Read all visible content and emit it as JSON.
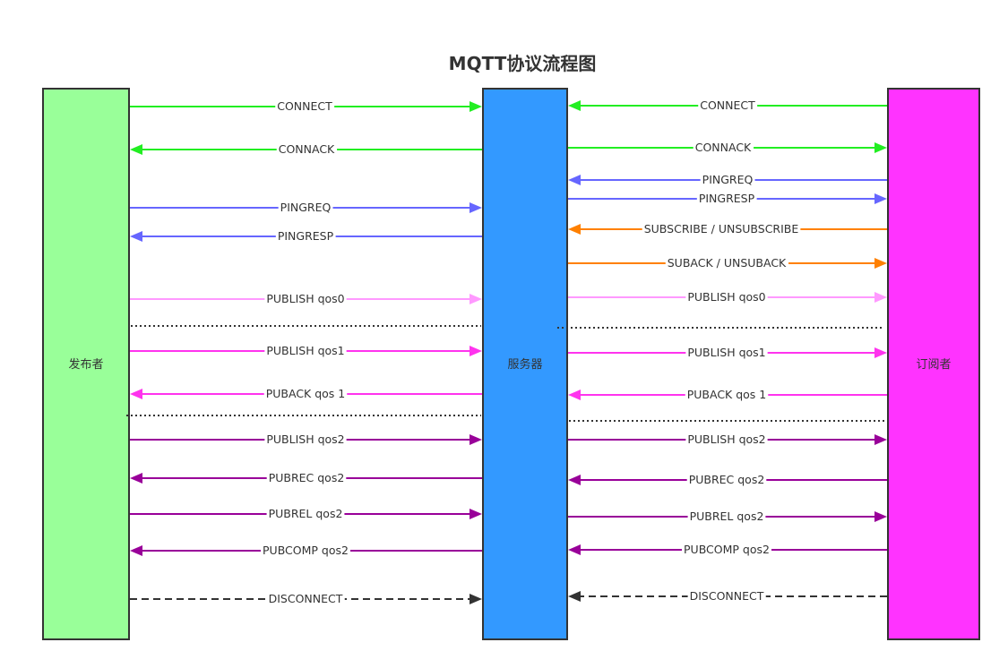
{
  "title": "MQTT协议流程图",
  "colors": {
    "connect": "#22ee22",
    "ping": "#6666ff",
    "subscribe": "#ff8000",
    "qos0": "#ff99ff",
    "qos1": "#ff33ee",
    "qos2": "#990099",
    "disconnect": "#333333",
    "separator": "#333333"
  },
  "lanes": [
    {
      "id": "publisher",
      "label": "发布者",
      "fill": "#99ff99"
    },
    {
      "id": "server",
      "label": "服务器",
      "fill": "#3399ff"
    },
    {
      "id": "subscriber",
      "label": "订阅者",
      "fill": "#ff33ff"
    }
  ],
  "messages_left": [
    {
      "label": "CONNECT",
      "direction": "to-server",
      "color": "connect",
      "style": "solid"
    },
    {
      "label": "CONNACK",
      "direction": "to-client",
      "color": "connect",
      "style": "solid"
    },
    {
      "label": "PINGREQ",
      "direction": "to-server",
      "color": "ping",
      "style": "solid"
    },
    {
      "label": "PINGRESP",
      "direction": "to-client",
      "color": "ping",
      "style": "solid"
    },
    {
      "label": "PUBLISH qos0",
      "direction": "to-server",
      "color": "qos0",
      "style": "solid"
    },
    {
      "label": "PUBLISH qos1",
      "direction": "to-server",
      "color": "qos1",
      "style": "solid"
    },
    {
      "label": "PUBACK qos 1",
      "direction": "to-client",
      "color": "qos1",
      "style": "solid"
    },
    {
      "label": "PUBLISH qos2",
      "direction": "to-server",
      "color": "qos2",
      "style": "solid"
    },
    {
      "label": "PUBREC qos2",
      "direction": "to-client",
      "color": "qos2",
      "style": "solid"
    },
    {
      "label": "PUBREL qos2",
      "direction": "to-server",
      "color": "qos2",
      "style": "solid"
    },
    {
      "label": "PUBCOMP qos2",
      "direction": "to-client",
      "color": "qos2",
      "style": "solid"
    },
    {
      "label": "DISCONNECT",
      "direction": "to-server",
      "color": "disconnect",
      "style": "dashed"
    }
  ],
  "messages_right": [
    {
      "label": "CONNECT",
      "direction": "to-server",
      "color": "connect",
      "style": "solid"
    },
    {
      "label": "CONNACK",
      "direction": "to-client",
      "color": "connect",
      "style": "solid"
    },
    {
      "label": "PINGREQ",
      "direction": "to-server",
      "color": "ping",
      "style": "solid"
    },
    {
      "label": "PINGRESP",
      "direction": "to-client",
      "color": "ping",
      "style": "solid"
    },
    {
      "label": "SUBSCRIBE / UNSUBSCRIBE",
      "direction": "to-server",
      "color": "subscribe",
      "style": "solid"
    },
    {
      "label": "SUBACK / UNSUBACK",
      "direction": "to-client",
      "color": "subscribe",
      "style": "solid"
    },
    {
      "label": "PUBLISH qos0",
      "direction": "to-client",
      "color": "qos0",
      "style": "solid"
    },
    {
      "label": "PUBLISH qos1",
      "direction": "to-client",
      "color": "qos1",
      "style": "solid"
    },
    {
      "label": "PUBACK qos 1",
      "direction": "to-server",
      "color": "qos1",
      "style": "solid"
    },
    {
      "label": "PUBLISH qos2",
      "direction": "to-client",
      "color": "qos2",
      "style": "solid"
    },
    {
      "label": "PUBREC qos2",
      "direction": "to-server",
      "color": "qos2",
      "style": "solid"
    },
    {
      "label": "PUBREL qos2",
      "direction": "to-client",
      "color": "qos2",
      "style": "solid"
    },
    {
      "label": "PUBCOMP qos2",
      "direction": "to-server",
      "color": "qos2",
      "style": "solid"
    },
    {
      "label": "DISCONNECT",
      "direction": "to-server",
      "color": "disconnect",
      "style": "dashed"
    }
  ]
}
